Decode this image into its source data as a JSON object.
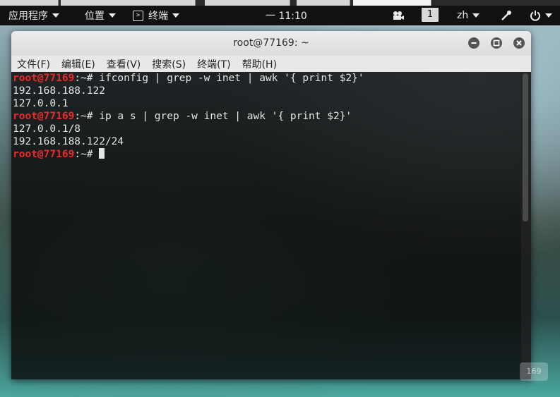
{
  "topbar": {
    "applications": "应用程序",
    "places": "位置",
    "terminal_app": "终端",
    "clock": "一 11:10",
    "workspace": "1",
    "lang": "zh"
  },
  "window": {
    "title": "root@77169: ~",
    "menu": [
      "文件(F)",
      "编辑(E)",
      "查看(V)",
      "搜索(S)",
      "终端(T)",
      "帮助(H)"
    ]
  },
  "terminal": {
    "prompt_user": "root@77169",
    "prompt_suffix": ":~# ",
    "cmd1": "ifconfig | grep -w inet | awk '{ print $2}'",
    "out1": [
      "192.168.188.122",
      "127.0.0.1"
    ],
    "cmd2": "ip a s | grep -w inet | awk '{ print $2}'",
    "out2": [
      "127.0.0.1/8",
      "192.168.188.122/24"
    ]
  },
  "watermark": "169",
  "colors": {
    "prompt": "#ef2929",
    "terminal_bg": "#0a0a0a",
    "topbar_bg": "#111111"
  }
}
